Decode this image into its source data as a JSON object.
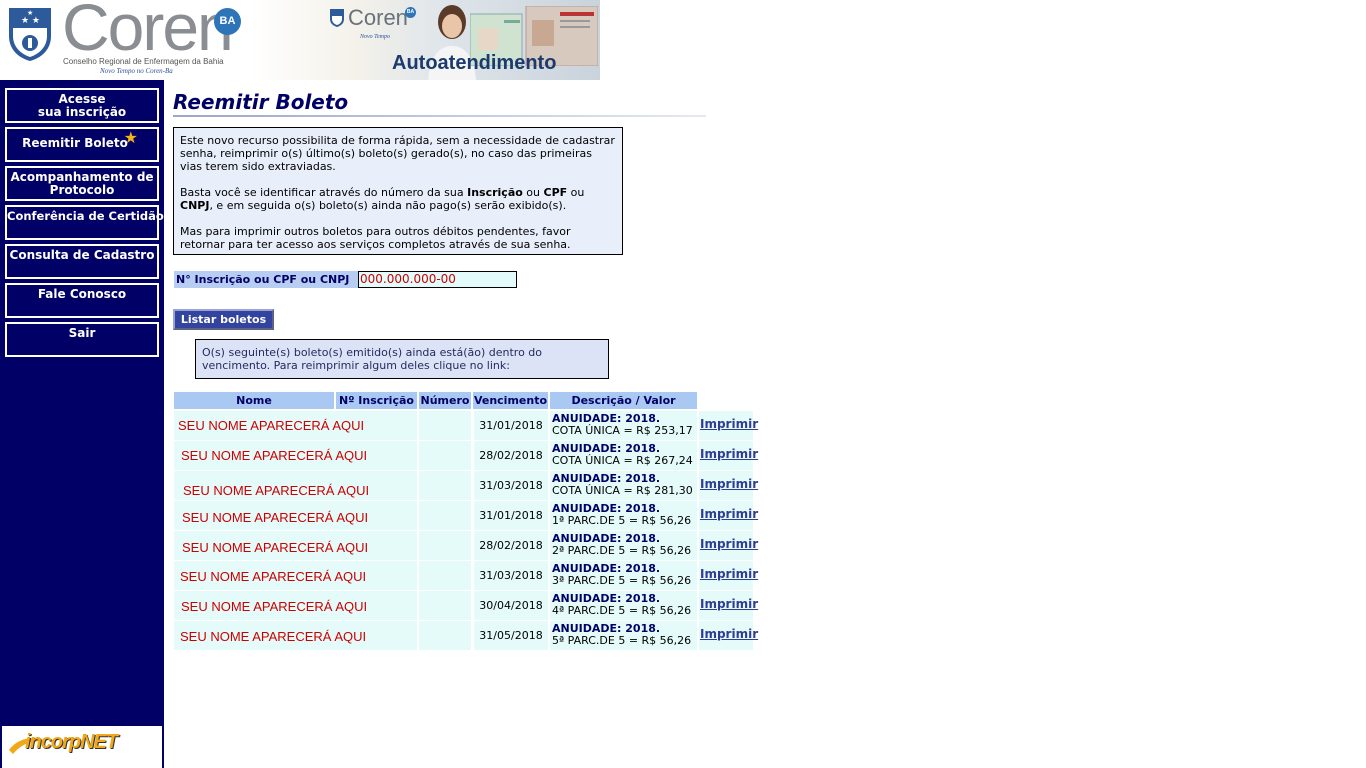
{
  "header": {
    "brand": "Coren",
    "brand_badge": "BA",
    "subtitle": "Conselho Regional de Enfermagem da Bahia",
    "slogan": "Novo Tempo no Coren-Ba",
    "banner_brand": "Coren",
    "banner_badge": "BA",
    "banner_slogan": "Novo Tempo",
    "banner_title": "Autoatendimento"
  },
  "sidebar": {
    "items": [
      {
        "line1": "Acesse",
        "line2": "sua inscrição"
      },
      {
        "line1": "Reemitir Boleto",
        "line2": ""
      },
      {
        "line1": "Acompanhamento de",
        "line2": "Protocolo"
      },
      {
        "line1": "Conferência de Certidão",
        "line2": ""
      },
      {
        "line1": "Consulta de Cadastro",
        "line2": ""
      },
      {
        "line1": "Fale Conosco",
        "line2": ""
      },
      {
        "line1": "Sair",
        "line2": ""
      }
    ],
    "footer_logo": "incorpNET"
  },
  "main": {
    "title": "Reemitir Boleto",
    "info": {
      "p1": "Este novo recurso possibilita de forma rápida, sem a necessidade de cadastrar senha, reimprimir o(s) último(s) boleto(s) gerado(s), no caso das primeiras vias terem sido extraviadas.",
      "p2_a": "Basta você se identificar através do número da sua ",
      "p2_b": "Inscrição",
      "p2_c": " ou ",
      "p2_d": "CPF",
      "p2_e": " ou ",
      "p2_f": "CNPJ",
      "p2_g": ", e em seguida o(s) boleto(s) ainda não pago(s) serão exibido(s).",
      "p3": "Mas para imprimir outros boletos para outros débitos pendentes, favor retornar para ter acesso aos serviços completos através de sua senha."
    },
    "search_label": "N° Inscrição ou CPF ou CNPJ",
    "search_value": "000.000.000-00",
    "list_button": "Listar boletos",
    "notice": "O(s) seguinte(s) boleto(s) emitido(s) ainda está(ão) dentro do vencimento. Para reimprimir algum deles clique no link:",
    "table": {
      "headers": [
        "Nome",
        "Nº Inscrição",
        "Número",
        "Vencimento",
        "Descrição / Valor"
      ],
      "rows": [
        {
          "name": "SEU NOME APARECERÁ AQUI",
          "inscricao": "",
          "numero": "",
          "vencimento": "31/01/2018",
          "desc_title": "ANUIDADE: 2018.",
          "desc_value": "COTA ÚNICA = R$ 253,17",
          "link": "Imprimir"
        },
        {
          "name": "SEU NOME APARECERÁ AQUI",
          "inscricao": "",
          "numero": "",
          "vencimento": "28/02/2018",
          "desc_title": "ANUIDADE: 2018.",
          "desc_value": "COTA ÚNICA = R$ 267,24",
          "link": "Imprimir"
        },
        {
          "name": "SEU NOME APARECERÁ AQUI",
          "inscricao": "",
          "numero": "",
          "vencimento": "31/03/2018",
          "desc_title": "ANUIDADE: 2018.",
          "desc_value": "COTA ÚNICA = R$ 281,30",
          "link": "Imprimir"
        },
        {
          "name": "SEU NOME APARECERÁ AQUI",
          "inscricao": "",
          "numero": "",
          "vencimento": "31/01/2018",
          "desc_title": "ANUIDADE: 2018.",
          "desc_value": "1ª PARC.DE 5 = R$ 56,26",
          "link": "Imprimir"
        },
        {
          "name": "SEU NOME APARECERÁ AQUI",
          "inscricao": "",
          "numero": "",
          "vencimento": "28/02/2018",
          "desc_title": "ANUIDADE: 2018.",
          "desc_value": "2ª PARC.DE 5 = R$ 56,26",
          "link": "Imprimir"
        },
        {
          "name": "SEU NOME APARECERÁ AQUI",
          "inscricao": "",
          "numero": "",
          "vencimento": "31/03/2018",
          "desc_title": "ANUIDADE: 2018.",
          "desc_value": "3ª PARC.DE 5 = R$ 56,26",
          "link": "Imprimir"
        },
        {
          "name": "SEU NOME APARECERÁ AQUI",
          "inscricao": "",
          "numero": "",
          "vencimento": "30/04/2018",
          "desc_title": "ANUIDADE: 2018.",
          "desc_value": "4ª PARC.DE 5 = R$ 56,26",
          "link": "Imprimir"
        },
        {
          "name": "SEU NOME APARECERÁ AQUI",
          "inscricao": "",
          "numero": "",
          "vencimento": "31/05/2018",
          "desc_title": "ANUIDADE: 2018.",
          "desc_value": "5ª PARC.DE 5 = R$ 56,26",
          "link": "Imprimir"
        }
      ]
    }
  },
  "colors": {
    "sidebar_bg": "#000066",
    "header_cell": "#a9c8f2",
    "row_bg": "#e4fbfa",
    "name_text": "#cc0000",
    "link": "#2f3b94"
  }
}
